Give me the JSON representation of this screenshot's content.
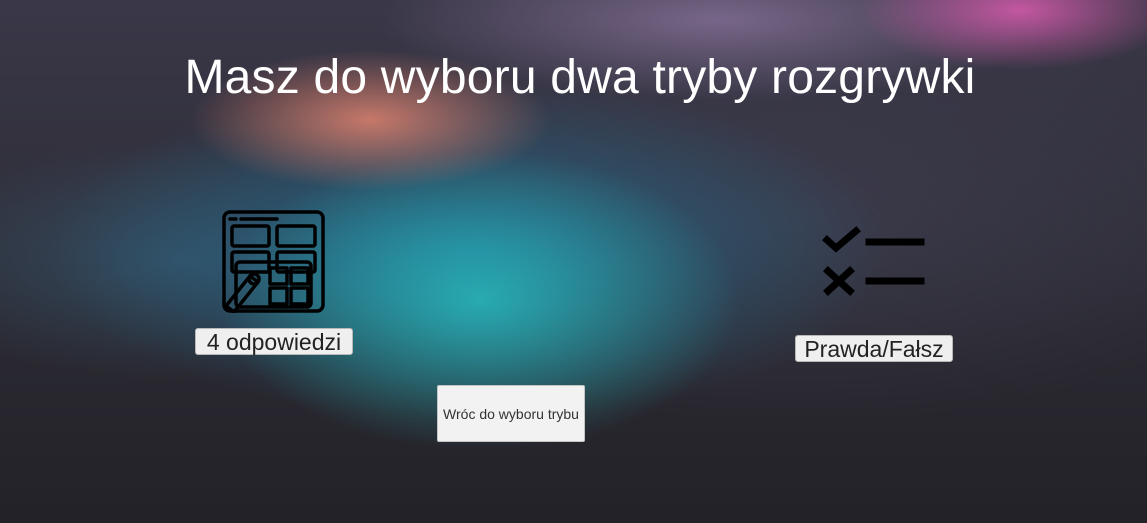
{
  "header": {
    "title": "Masz do wyboru dwa tryby rozgrywki"
  },
  "modes": [
    {
      "icon": "grid-pencil-icon",
      "label": "4 odpowiedzi"
    },
    {
      "icon": "checklist-true-false-icon",
      "label": "Prawda/Fałsz"
    }
  ],
  "back": {
    "label": "Wróc do wyboru trybu"
  },
  "colors": {
    "title_text": "#ffffff",
    "icon": "#000000",
    "button_bg": "#efefef"
  }
}
